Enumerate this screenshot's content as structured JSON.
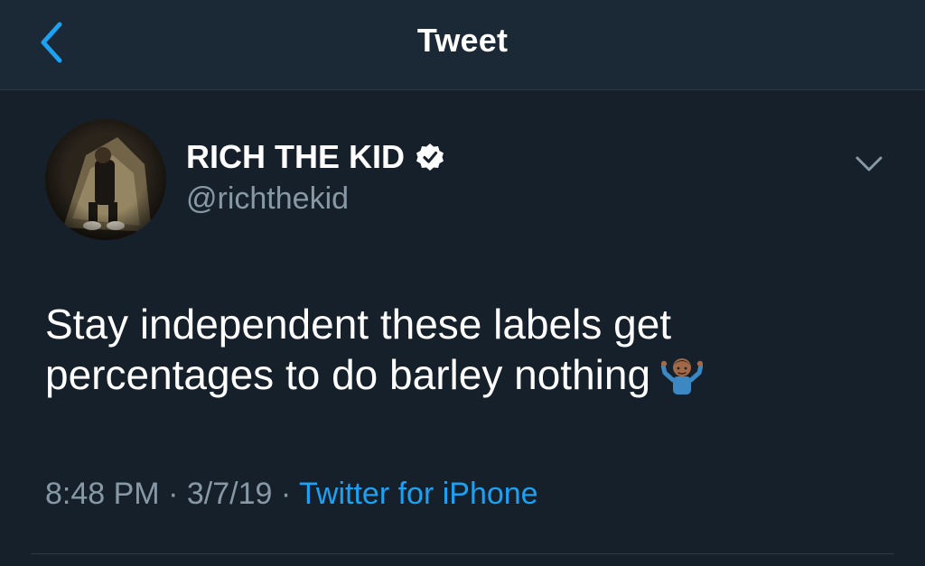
{
  "header": {
    "title": "Tweet",
    "back_icon": "chevron-left-icon"
  },
  "tweet": {
    "author": {
      "display_name": "RICH THE KID",
      "handle": "@richthekid",
      "verified": true
    },
    "text_lines": [
      "Stay independent these labels get",
      "percentages to do barley nothing"
    ],
    "emoji": "man-shrugging-emoji",
    "time": "8:48 PM",
    "separator": "·",
    "date": "3/7/19",
    "source": "Twitter for iPhone"
  },
  "colors": {
    "background": "#15202b",
    "header_background": "#1b2836",
    "accent": "#1da1f2",
    "secondary_text": "#8899a6",
    "divider": "#2b3947"
  }
}
